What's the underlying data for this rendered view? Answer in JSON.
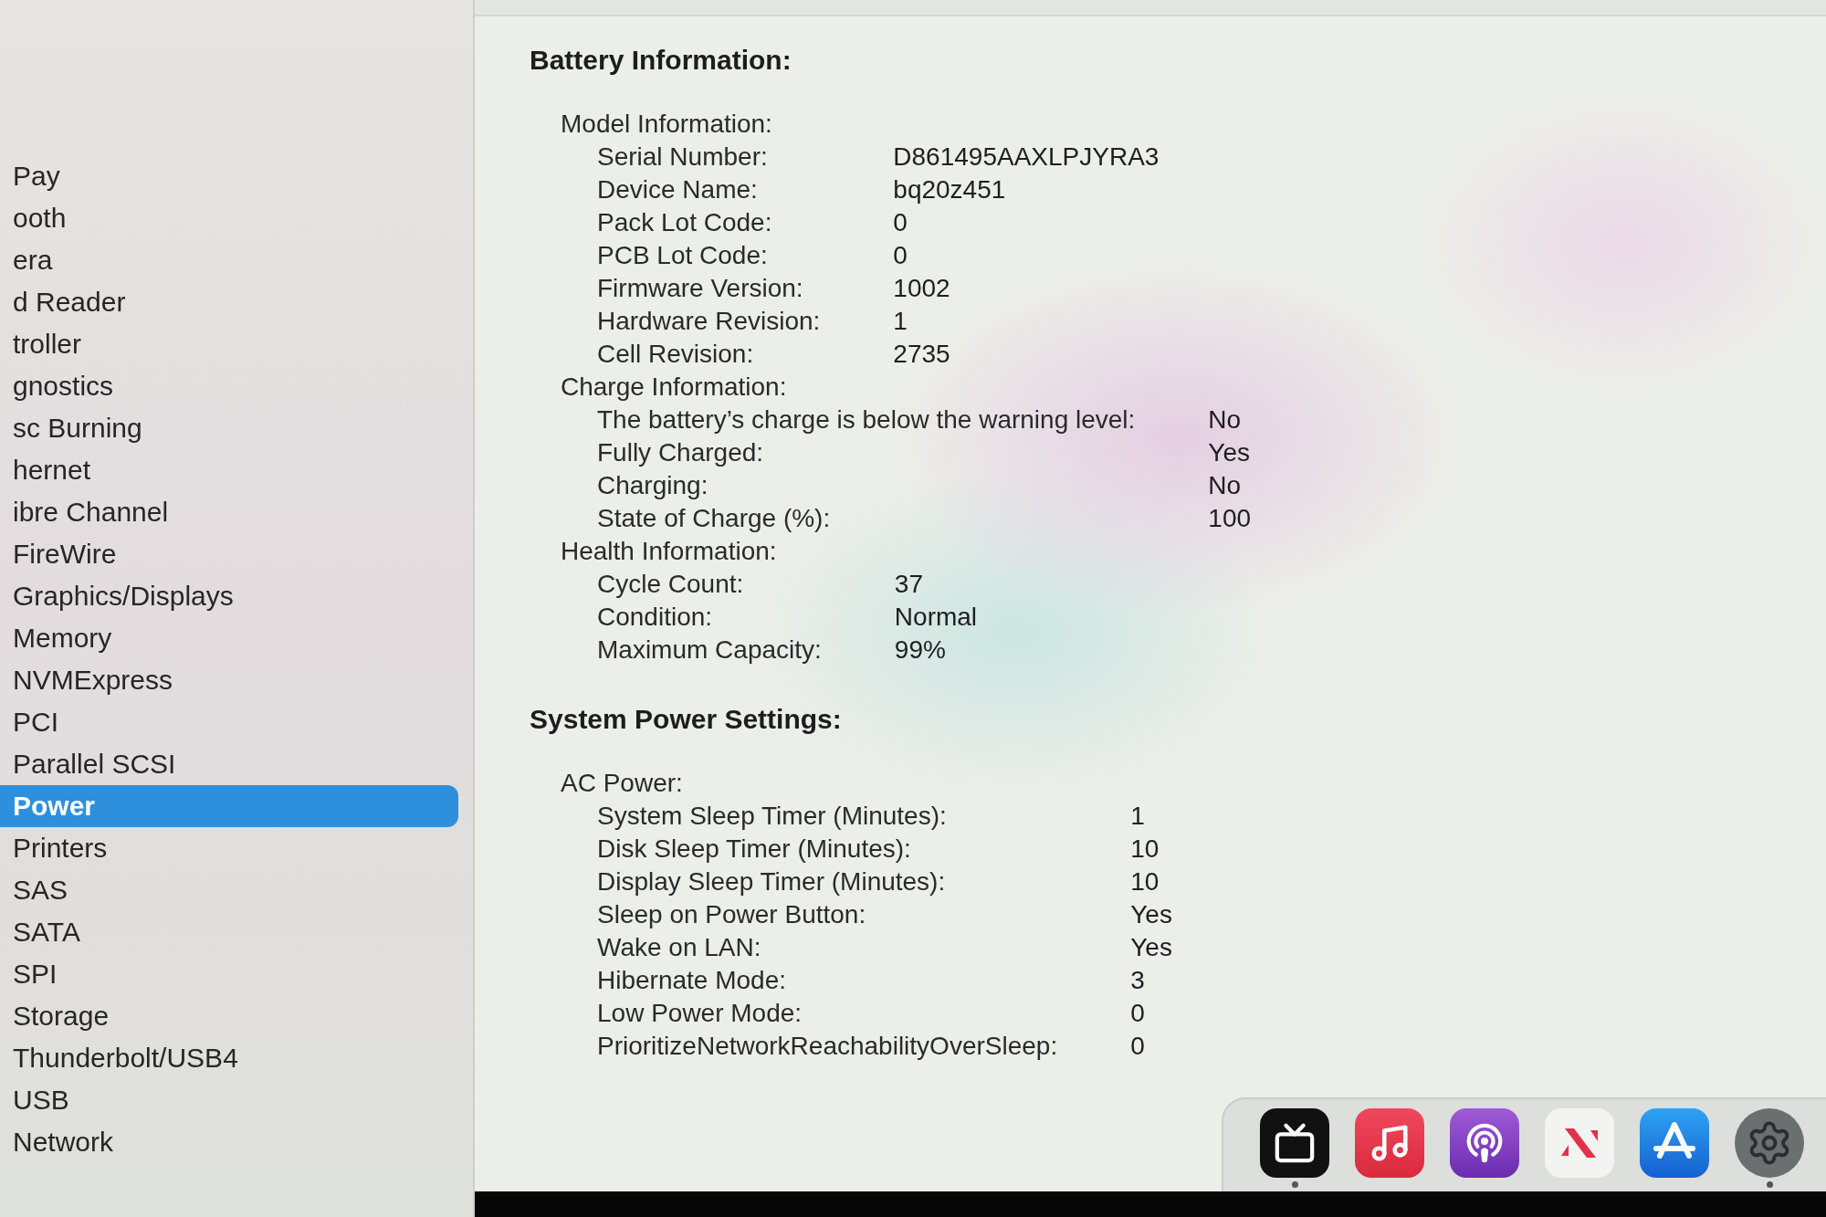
{
  "sidebar": {
    "items": [
      {
        "label": "Pay",
        "selected": false
      },
      {
        "label": "ooth",
        "selected": false
      },
      {
        "label": "era",
        "selected": false
      },
      {
        "label": "d Reader",
        "selected": false
      },
      {
        "label": "troller",
        "selected": false
      },
      {
        "label": "gnostics",
        "selected": false
      },
      {
        "label": "sc Burning",
        "selected": false
      },
      {
        "label": "hernet",
        "selected": false
      },
      {
        "label": "ibre Channel",
        "selected": false
      },
      {
        "label": "FireWire",
        "selected": false
      },
      {
        "label": "Graphics/Displays",
        "selected": false
      },
      {
        "label": "Memory",
        "selected": false
      },
      {
        "label": "NVMExpress",
        "selected": false
      },
      {
        "label": "PCI",
        "selected": false
      },
      {
        "label": "Parallel SCSI",
        "selected": false
      },
      {
        "label": "Power",
        "selected": true
      },
      {
        "label": "Printers",
        "selected": false
      },
      {
        "label": "SAS",
        "selected": false
      },
      {
        "label": "SATA",
        "selected": false
      },
      {
        "label": "SPI",
        "selected": false
      },
      {
        "label": "Storage",
        "selected": false
      },
      {
        "label": "Thunderbolt/USB4",
        "selected": false
      },
      {
        "label": "USB",
        "selected": false
      },
      {
        "label": "Network",
        "selected": false
      }
    ]
  },
  "sections": [
    {
      "title": "Battery Information:",
      "groups": [
        {
          "title": "Model Information:",
          "rows": [
            {
              "label": "Serial Number:",
              "value": "D861495AAXLPJYRA3"
            },
            {
              "label": "Device Name:",
              "value": "bq20z451"
            },
            {
              "label": "Pack Lot Code:",
              "value": "0"
            },
            {
              "label": "PCB Lot Code:",
              "value": "0"
            },
            {
              "label": "Firmware Version:",
              "value": "1002"
            },
            {
              "label": "Hardware Revision:",
              "value": "1"
            },
            {
              "label": "Cell Revision:",
              "value": "2735"
            }
          ]
        },
        {
          "title": "Charge Information:",
          "rows": [
            {
              "label": "The battery’s charge is below the warning level:",
              "value": "No"
            },
            {
              "label": "Fully Charged:",
              "value": "Yes"
            },
            {
              "label": "Charging:",
              "value": "No"
            },
            {
              "label": "State of Charge (%):",
              "value": "100"
            }
          ]
        },
        {
          "title": "Health Information:",
          "rows": [
            {
              "label": "Cycle Count:",
              "value": "37"
            },
            {
              "label": "Condition:",
              "value": "Normal"
            },
            {
              "label": "Maximum Capacity:",
              "value": "99%"
            }
          ]
        }
      ]
    },
    {
      "title": "System Power Settings:",
      "groups": [
        {
          "title": "AC Power:",
          "rows": [
            {
              "label": "System Sleep Timer (Minutes):",
              "value": "1"
            },
            {
              "label": "Disk Sleep Timer (Minutes):",
              "value": "10"
            },
            {
              "label": "Display Sleep Timer (Minutes):",
              "value": "10"
            },
            {
              "label": "Sleep on Power Button:",
              "value": "Yes"
            },
            {
              "label": "Wake on LAN:",
              "value": "Yes"
            },
            {
              "label": "Hibernate Mode:",
              "value": "3"
            },
            {
              "label": "Low Power Mode:",
              "value": "0"
            },
            {
              "label": "PrioritizeNetworkReachabilityOverSleep:",
              "value": "0"
            }
          ]
        }
      ]
    }
  ],
  "dock": {
    "items": [
      {
        "kind": "tv",
        "running": true
      },
      {
        "kind": "music",
        "running": false
      },
      {
        "kind": "podcasts",
        "running": false
      },
      {
        "kind": "news",
        "running": false
      },
      {
        "kind": "store",
        "running": false
      },
      {
        "kind": "settings",
        "running": true
      }
    ]
  }
}
